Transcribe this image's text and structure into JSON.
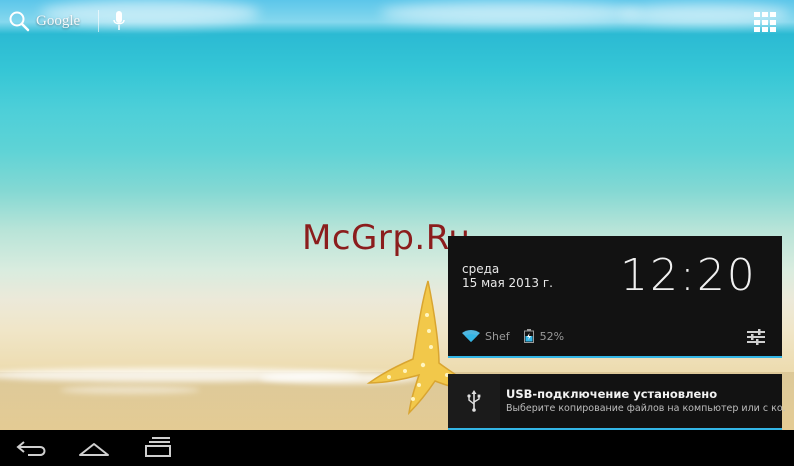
{
  "status_bar": {
    "search_label": "Google",
    "search_icon": "search-icon",
    "voice_icon": "microphone-icon",
    "apps_icon": "all-apps-grid-icon"
  },
  "watermark": "McGrp.Ru",
  "notification_panel": {
    "day": "среда",
    "date": "15 мая 2013 г.",
    "time": "12:20",
    "wifi_name": "Shef",
    "battery_level": "52%",
    "wifi_icon": "wifi-icon",
    "battery_icon": "battery-charging-icon",
    "settings_icon": "settings-sliders-icon",
    "accent_color": "#33b5e5"
  },
  "notifications": [
    {
      "icon": "usb-icon",
      "title": "USB-подключение установлено",
      "text": "Выберите копирование файлов на компьютер или с ко."
    }
  ],
  "nav_bar": {
    "back_icon": "back-icon",
    "home_icon": "home-icon",
    "recent_icon": "recent-apps-icon"
  }
}
